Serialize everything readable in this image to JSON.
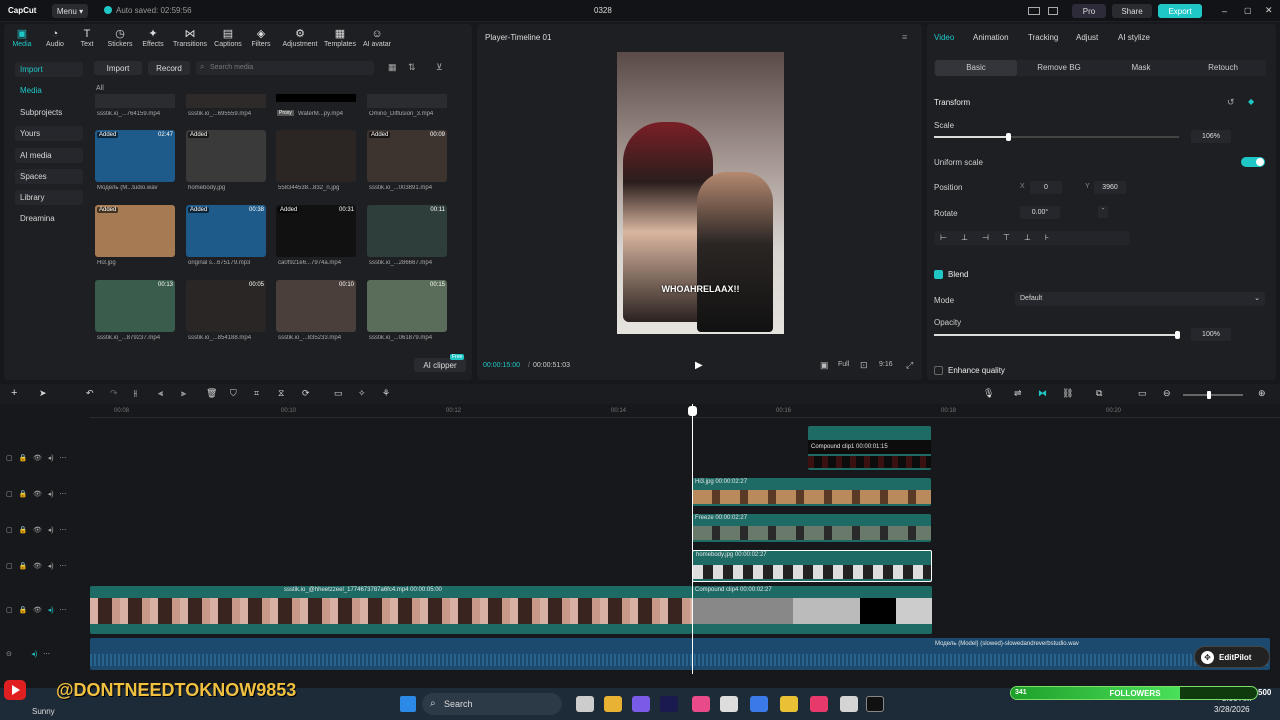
{
  "app": {
    "logo": "CapCut",
    "menu_label": "Menu",
    "autosave": "Auto saved: 02:59:56",
    "project_title": "0328",
    "pro_label": "Pro",
    "share_label": "Share",
    "export_label": "Export"
  },
  "toolbar": [
    {
      "label": "Media",
      "icon": "media-icon"
    },
    {
      "label": "Audio",
      "icon": "audio-icon"
    },
    {
      "label": "Text",
      "icon": "text-icon"
    },
    {
      "label": "Stickers",
      "icon": "stickers-icon"
    },
    {
      "label": "Effects",
      "icon": "effects-icon"
    },
    {
      "label": "Transitions",
      "icon": "transitions-icon"
    },
    {
      "label": "Captions",
      "icon": "captions-icon"
    },
    {
      "label": "Filters",
      "icon": "filters-icon"
    },
    {
      "label": "Adjustment",
      "icon": "adjustment-icon"
    },
    {
      "label": "Templates",
      "icon": "templates-icon"
    },
    {
      "label": "AI avatar",
      "icon": "ai-avatar-icon"
    }
  ],
  "sidebar": [
    {
      "label": "Import"
    },
    {
      "label": "Media"
    },
    {
      "label": "Subprojects"
    },
    {
      "label": "Yours"
    },
    {
      "label": "AI media"
    },
    {
      "label": "Spaces"
    },
    {
      "label": "Library"
    },
    {
      "label": "Dreamina"
    }
  ],
  "media": {
    "import_label": "Import",
    "record_label": "Record",
    "search_placeholder": "Search media",
    "filter_all": "All",
    "top_row": [
      "ssstik.io_...764159.mp4",
      "ssstik.io_...695559.mp4",
      "WaterM...py.mp4",
      "Omino_Diffusion_3.mp4"
    ],
    "proxy_label": "Proxy",
    "items": [
      {
        "name": "Модель (M...tudio.wav",
        "badge": "Added",
        "dur": "02:47",
        "bg": "#1f5b8a"
      },
      {
        "name": "homebody.jpg",
        "badge": "Added",
        "dur": "",
        "bg": "#3a3a3a"
      },
      {
        "name": "558344538...832_n.jpg",
        "badge": "",
        "dur": "",
        "bg": "#2b2523"
      },
      {
        "name": "ssstik.io_...003891.mp4",
        "badge": "Added",
        "dur": "00:09",
        "bg": "#3d3430"
      },
      {
        "name": "Hi3.jpg",
        "badge": "Added",
        "dur": "",
        "bg": "#a67a52"
      },
      {
        "name": "original s...675179.mp3",
        "badge": "Added",
        "dur": "00:38",
        "bg": "#1f5b8a"
      },
      {
        "name": "ca0f921e6...7974a.mp4",
        "badge": "Added",
        "dur": "00:31",
        "bg": "#111"
      },
      {
        "name": "ssstik.io_...286667.mp4",
        "badge": "",
        "dur": "00:11",
        "bg": "#2e3e3a"
      },
      {
        "name": "ssstik.io_...879237.mp4",
        "badge": "",
        "dur": "00:13",
        "bg": "#3a5c4c"
      },
      {
        "name": "ssstik.io_...854188.mp4",
        "badge": "",
        "dur": "00:05",
        "bg": "#2a2626"
      },
      {
        "name": "ssstik.io_...835233.mp4",
        "badge": "",
        "dur": "00:10",
        "bg": "#4a3f3a"
      },
      {
        "name": "ssstik.io_...061879.mp4",
        "badge": "",
        "dur": "00:15",
        "bg": "#5a6c5a"
      }
    ],
    "ai_clipper": "AI clipper",
    "free_badge": "Free"
  },
  "player": {
    "title": "Player-Timeline 01",
    "current": "00:00:15:00",
    "total": "00:00:51:03",
    "caption": "WHOAHRELAAX!!",
    "ratio": "9:16"
  },
  "inspector": {
    "tabs": [
      "Video",
      "Animation",
      "Tracking",
      "Adjust",
      "AI stylize"
    ],
    "subtabs": [
      "Basic",
      "Remove BG",
      "Mask",
      "Retouch"
    ],
    "transform_label": "Transform",
    "scale_label": "Scale",
    "scale_value": "106%",
    "scale_level": 0.3,
    "uniform_label": "Uniform scale",
    "position_label": "Position",
    "pos_x_label": "X",
    "pos_x": "0",
    "pos_y_label": "Y",
    "pos_y": "3960",
    "rotate_label": "Rotate",
    "rotate_value": "0.00°",
    "blend_label": "Blend",
    "mode_label": "Mode",
    "mode_value": "Default",
    "opacity_label": "Opacity",
    "opacity_value": "100%",
    "opacity_level": 1.0,
    "enhance_label": "Enhance quality"
  },
  "timeline": {
    "ruler": [
      "00:08",
      "00:10",
      "00:12",
      "00:14",
      "00:16",
      "00:18",
      "00:20"
    ],
    "clips": {
      "compound1": "Compound clip1  00:00:01:15",
      "hi3": "Hi3.jpg   00:00:02:27",
      "freeze": "Freeze   00:00:02:27",
      "homebody": "homebody.jpg   00:00:02:27",
      "main": "ssstik.io_@hheetzzeel_1774673787a6fc4.mp4   00:00:05:00",
      "compound_main": "Compound clip4   00:00:02:27",
      "audio": "Модель (Model) (slowed)-slowedandreverbstudio.wav"
    },
    "editpilot": "EditPilot"
  },
  "overlay": {
    "watermark": "@DONTNEEDTOKNOW9853",
    "followers_label": "FOLLOWERS",
    "followers_count": "341",
    "followers_goal": "500",
    "followers_level": 0.682,
    "user": "Sunny"
  },
  "taskbar": {
    "search": "Search",
    "time": "3:00 AM",
    "date": "3/28/2026"
  }
}
